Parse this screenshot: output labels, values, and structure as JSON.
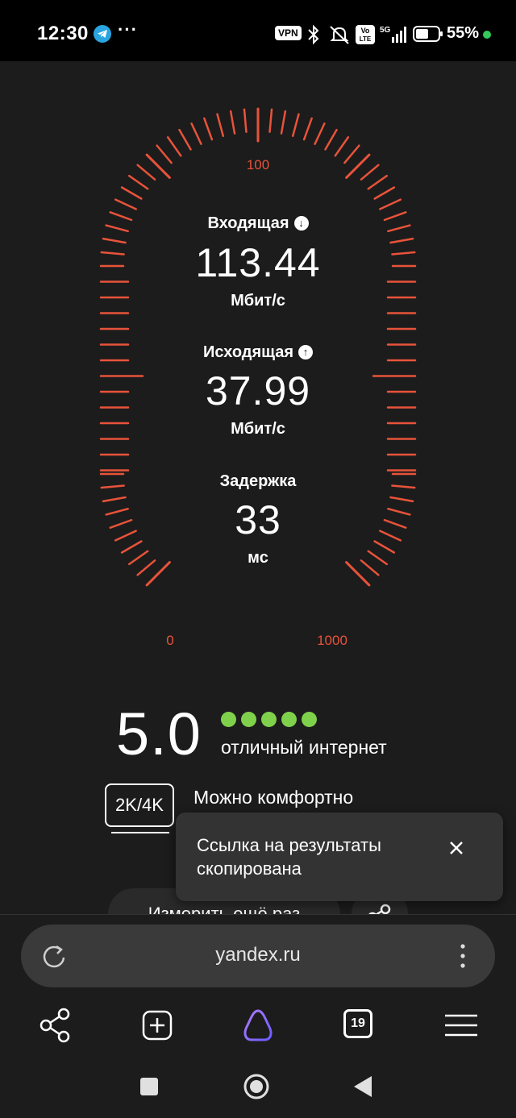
{
  "status_bar": {
    "time": "12:30",
    "dots": "···",
    "vpn": "VPN",
    "volte": "Vo LTE",
    "network": "5G",
    "battery_percent": "55%"
  },
  "speedtest": {
    "gauge": {
      "scale_labels": {
        "min": "0",
        "mid": "100",
        "max": "1000"
      },
      "accent_color": "#e8533a"
    },
    "download": {
      "label": "Входящая",
      "value": "113.44",
      "unit": "Мбит/с",
      "icon": "arrow-down-icon"
    },
    "upload": {
      "label": "Исходящая",
      "value": "37.99",
      "unit": "Мбит/с",
      "icon": "arrow-up-icon"
    },
    "latency": {
      "label": "Задержка",
      "value": "33",
      "unit": "мс"
    },
    "score": {
      "value": "5.0",
      "stars": 5,
      "text": "отличный интернет",
      "star_color": "#7fd14b"
    },
    "quality_badge": {
      "label": "2K/4K",
      "text": "Можно комфортно"
    },
    "remeasure_button": "Измерить ещё раз"
  },
  "toast": {
    "message": "Ссылка на результаты скопирована",
    "close_icon": "close-icon"
  },
  "browser": {
    "url": "yandex.ru",
    "tabs_count": "19",
    "toolbar_icons": [
      "share-icon",
      "new-tab-icon",
      "alice-icon",
      "tabs-icon",
      "menu-icon"
    ]
  },
  "system_nav": [
    "recents-icon",
    "home-icon",
    "back-icon"
  ]
}
